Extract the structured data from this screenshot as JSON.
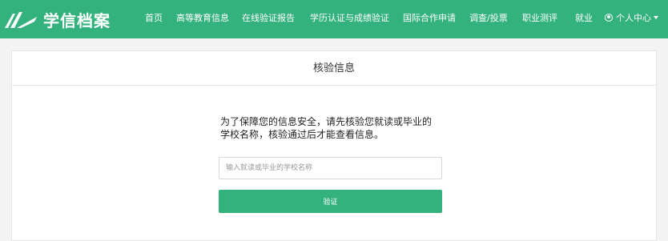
{
  "brand": {
    "name": "学信档案",
    "logo_icon": "xuexin-logo-icon"
  },
  "nav": {
    "items": [
      {
        "label": "首页"
      },
      {
        "label": "高等教育信息"
      },
      {
        "label": "在线验证报告"
      },
      {
        "label": "学历认证与成绩验证"
      },
      {
        "label": "国际合作申请"
      },
      {
        "label": "调查/投票"
      },
      {
        "label": "职业测评"
      },
      {
        "label": "就业"
      }
    ],
    "user_center": {
      "label": "个人中心",
      "icon": "user-circle-icon",
      "caret_icon": "caret-down-icon"
    }
  },
  "panel": {
    "title": "核验信息",
    "prompt_line1": "为了保障您的信息安全，请先核验您就读或毕业的",
    "prompt_line2": "学校名称，核验通过后才能查看信息。",
    "input": {
      "value": "",
      "placeholder": "输入就读或毕业的学校名称"
    },
    "verify_label": "验证"
  },
  "colors": {
    "brand_green": "#34b27d",
    "page_bg": "#f3f3f3",
    "panel_bg": "#ffffff"
  }
}
